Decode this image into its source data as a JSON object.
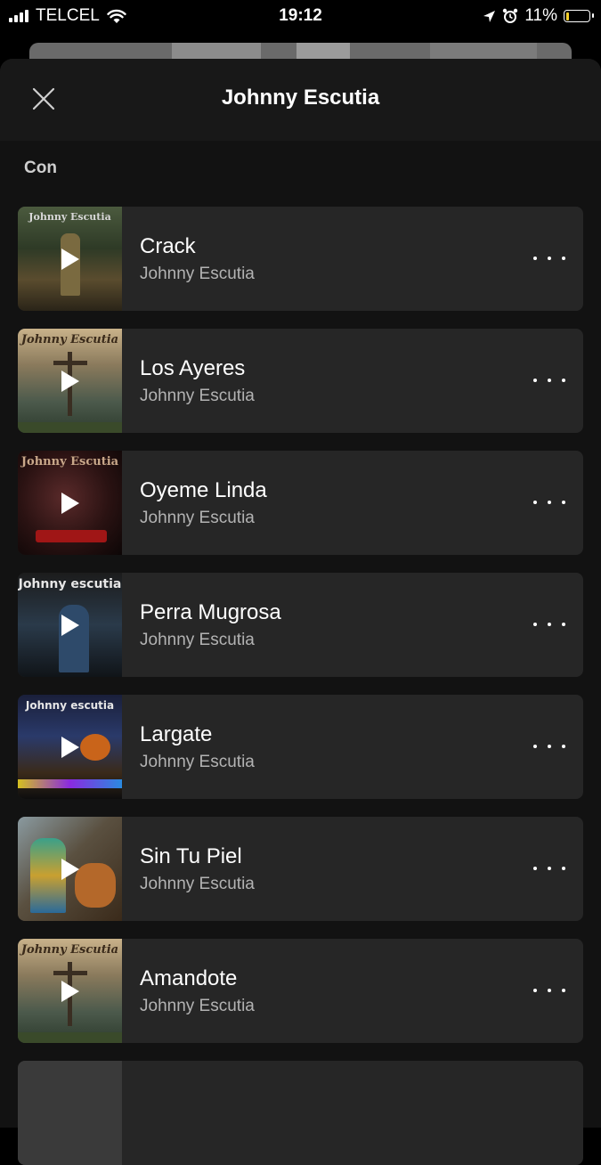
{
  "status_bar": {
    "carrier": "TELCEL",
    "time": "19:12",
    "battery": "11%",
    "battery_level": 0.11
  },
  "sheet": {
    "title": "Johnny Escutia",
    "section": "Con"
  },
  "tracks": [
    {
      "title": "Crack",
      "artist": "Johnny Escutia",
      "art_text": "Johnny Escutia"
    },
    {
      "title": "Los Ayeres",
      "artist": "Johnny Escutia",
      "art_text": "Johnny Escutia"
    },
    {
      "title": "Oyeme Linda",
      "artist": "Johnny Escutia",
      "art_text": "Johnny Escutia"
    },
    {
      "title": "Perra Mugrosa",
      "artist": "Johnny Escutia",
      "art_text": "Johnny escutia"
    },
    {
      "title": "Largate",
      "artist": "Johnny Escutia",
      "art_text": "Johnny escutia"
    },
    {
      "title": "Sin Tu Piel",
      "artist": "Johnny Escutia",
      "art_text": ""
    },
    {
      "title": "Amandote",
      "artist": "Johnny Escutia",
      "art_text": "Johnny Escutia"
    }
  ],
  "colors": {
    "sheet_bg": "#121212",
    "row_bg": "#262626",
    "secondary_text": "#b3b3b3",
    "battery_yellow": "#f5d02a"
  },
  "icons": [
    "close-icon",
    "play-icon",
    "more-options-icon",
    "wifi-icon",
    "location-icon",
    "alarm-icon"
  ]
}
